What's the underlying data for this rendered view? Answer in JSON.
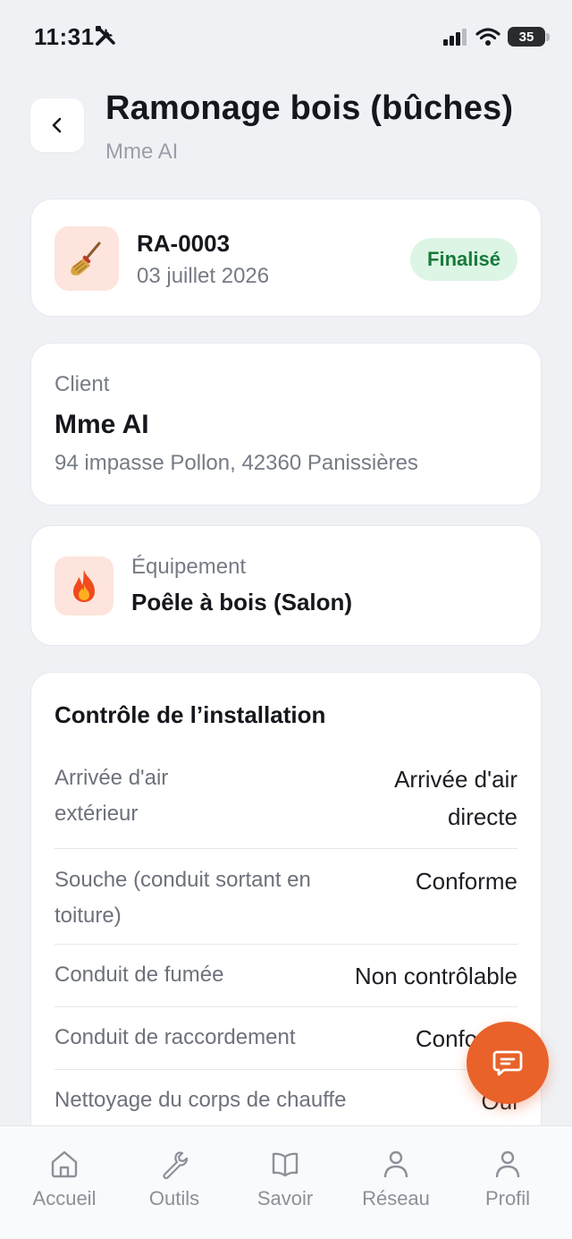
{
  "status_bar": {
    "time": "11:31",
    "battery": "35"
  },
  "header": {
    "title": "Ramonage bois (bûches)",
    "subtitle": "Mme AI"
  },
  "reference": {
    "code": "RA-0003",
    "date": "03 juillet 2026",
    "status": "Finalisé",
    "icon": "broom-icon"
  },
  "client": {
    "label": "Client",
    "name": "Mme AI",
    "address": "94 impasse Pollon, 42360 Panissières"
  },
  "equipment": {
    "label": "Équipement",
    "name": "Poêle à bois (Salon)",
    "icon": "fire-icon"
  },
  "control": {
    "title": "Contrôle de l’installation",
    "rows": [
      {
        "label_line1": "Arrivée d'air",
        "label_line2": "extérieur",
        "value_line1": "Arrivée d'air",
        "value_line2": "directe"
      },
      {
        "label_line1": "Souche (conduit sortant en",
        "label_line2": "toiture)",
        "value_line1": "Conforme"
      },
      {
        "label_line1": "Conduit de fumée",
        "value_line1": "Non contrôlable"
      },
      {
        "label_line1": "Conduit de raccordement",
        "value_line1": "Conforme"
      },
      {
        "label_line1": "Nettoyage du corps de chauffe",
        "value_line1": "Oui"
      }
    ]
  },
  "tabs": [
    {
      "label": "Accueil",
      "icon": "home-icon"
    },
    {
      "label": "Outils",
      "icon": "wrench-icon"
    },
    {
      "label": "Savoir",
      "icon": "book-icon"
    },
    {
      "label": "Réseau",
      "icon": "network-person-icon"
    },
    {
      "label": "Profil",
      "icon": "profile-icon"
    }
  ],
  "colors": {
    "accent": "#e8622a",
    "badge_bg": "#dcf5e4",
    "badge_text": "#177a3b",
    "icon_bg": "#fde4dc",
    "background": "#eff1f5"
  }
}
